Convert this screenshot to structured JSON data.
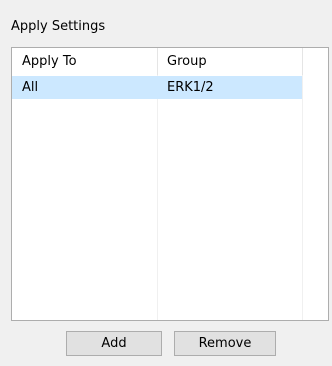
{
  "group": {
    "title": "Apply Settings"
  },
  "list": {
    "columns": [
      "Apply To",
      "Group"
    ],
    "rows": [
      {
        "apply_to": "All",
        "group": "ERK1/2",
        "selected": true
      }
    ],
    "selection_color": "#cce8ff"
  },
  "buttons": {
    "add_label": "Add",
    "remove_label": "Remove"
  }
}
